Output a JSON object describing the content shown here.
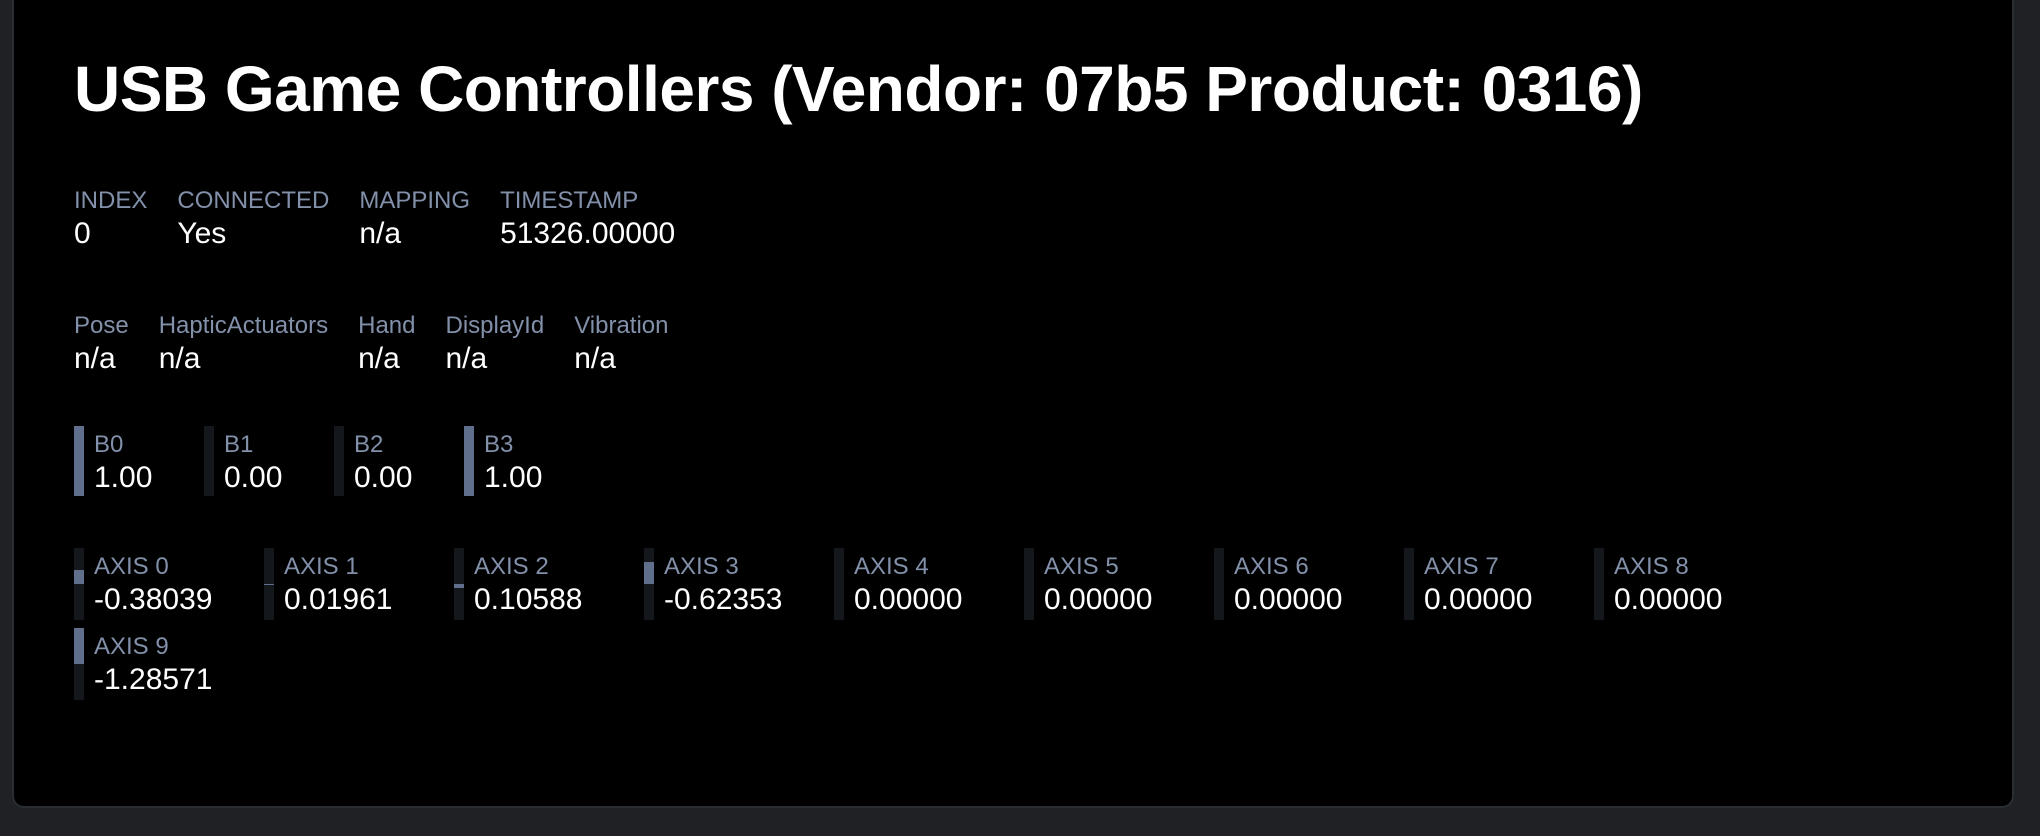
{
  "title": "USB Game Controllers (Vendor: 07b5 Product: 0316)",
  "info": [
    {
      "label": "INDEX",
      "value": "0"
    },
    {
      "label": "CONNECTED",
      "value": "Yes"
    },
    {
      "label": "MAPPING",
      "value": "n/a"
    },
    {
      "label": "TIMESTAMP",
      "value": "51326.00000"
    }
  ],
  "extensions": [
    {
      "label": "Pose",
      "value": "n/a"
    },
    {
      "label": "HapticActuators",
      "value": "n/a"
    },
    {
      "label": "Hand",
      "value": "n/a"
    },
    {
      "label": "DisplayId",
      "value": "n/a"
    },
    {
      "label": "Vibration",
      "value": "n/a"
    }
  ],
  "buttons": [
    {
      "label": "B0",
      "value": "1.00",
      "level": 1.0
    },
    {
      "label": "B1",
      "value": "0.00",
      "level": 0.0
    },
    {
      "label": "B2",
      "value": "0.00",
      "level": 0.0
    },
    {
      "label": "B3",
      "value": "1.00",
      "level": 1.0
    }
  ],
  "axes": [
    {
      "label": "AXIS 0",
      "value": "-0.38039",
      "level": -0.38039
    },
    {
      "label": "AXIS 1",
      "value": "0.01961",
      "level": 0.01961
    },
    {
      "label": "AXIS 2",
      "value": "0.10588",
      "level": 0.10588
    },
    {
      "label": "AXIS 3",
      "value": "-0.62353",
      "level": -0.62353
    },
    {
      "label": "AXIS 4",
      "value": "0.00000",
      "level": 0.0
    },
    {
      "label": "AXIS 5",
      "value": "0.00000",
      "level": 0.0
    },
    {
      "label": "AXIS 6",
      "value": "0.00000",
      "level": 0.0
    },
    {
      "label": "AXIS 7",
      "value": "0.00000",
      "level": 0.0
    },
    {
      "label": "AXIS 8",
      "value": "0.00000",
      "level": 0.0
    },
    {
      "label": "AXIS 9",
      "value": "-1.28571",
      "level": -1.28571
    }
  ],
  "colors": {
    "background": "#000000",
    "label": "#8290aa",
    "value": "#ffffff",
    "meter_fill": "#5f6f8c",
    "meter_track": "#14171c"
  }
}
